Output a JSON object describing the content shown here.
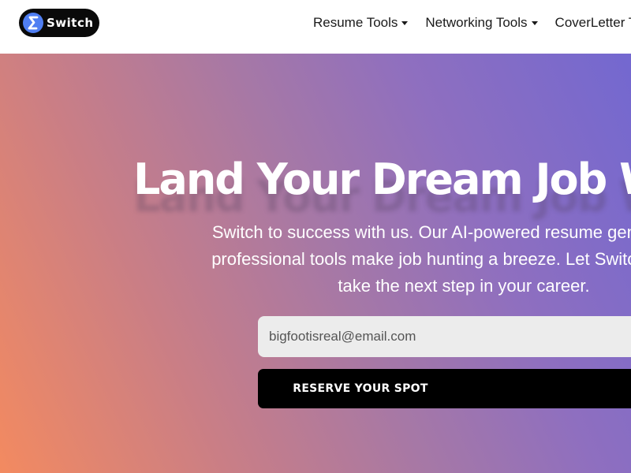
{
  "header": {
    "logo_text": "Switch",
    "nav": [
      {
        "label": "Resume Tools"
      },
      {
        "label": "Networking Tools"
      },
      {
        "label": "CoverLetter Tools"
      }
    ]
  },
  "hero": {
    "title": "Land Your Dream Job With Switch",
    "subtitle_lines": [
      "Switch to success with us. Our AI-powered resume generator and",
      "professional tools make job hunting a breeze. Let Switch help you",
      "take the next step in your career."
    ],
    "email_value": "bigfootisreal@email.com",
    "button_label": "RESERVE YOUR SPOT"
  },
  "colors": {
    "brand_blue": "#4f7ef2",
    "gradient_left": "#f38a60",
    "gradient_right": "#7368d0",
    "button_bg": "#000000"
  },
  "icons": {
    "logo": "switch-s-logo-icon",
    "dropdown": "caret-down-icon"
  }
}
